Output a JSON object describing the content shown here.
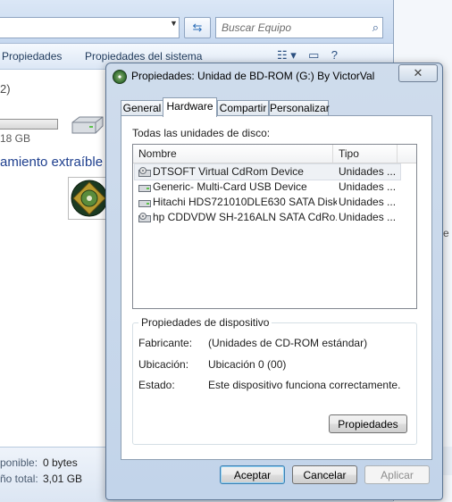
{
  "explorer": {
    "search_placeholder": "Buscar Equipo",
    "toolbar": {
      "properties_label": "Propiedades",
      "system_properties_label": "Propiedades del sistema"
    },
    "count_fragment": "2)",
    "size_fragment": "18 GB",
    "section_fragment": "amiento extraíble",
    "status": {
      "free_label": "ponible:",
      "free_value": "0 bytes",
      "total_label": "ño total:",
      "total_value": "3,01 GB"
    },
    "right_edge_letter": "e"
  },
  "dialog": {
    "title": "Propiedades: Unidad de BD-ROM (G:) By VictorVal",
    "close_glyph": "✕",
    "tabs": [
      {
        "label": "General"
      },
      {
        "label": "Hardware"
      },
      {
        "label": "Compartir"
      },
      {
        "label": "Personalizar"
      }
    ],
    "active_tab": "Hardware",
    "drives_label": "Todas las unidades de disco:",
    "columns": {
      "name": "Nombre",
      "type": "Tipo"
    },
    "devices": [
      {
        "name": "DTSOFT Virtual CdRom Device",
        "type": "Unidades ..."
      },
      {
        "name": "Generic- Multi-Card USB Device",
        "type": "Unidades ..."
      },
      {
        "name": "Hitachi HDS721010DLE630 SATA Disk...",
        "type": "Unidades ..."
      },
      {
        "name": "hp CDDVDW SH-216ALN SATA CdRo...",
        "type": "Unidades ..."
      }
    ],
    "device_properties": {
      "title": "Propiedades de dispositivo",
      "manufacturer_label": "Fabricante:",
      "manufacturer_value": "(Unidades de CD-ROM estándar)",
      "location_label": "Ubicación:",
      "location_value": "Ubicación 0 (00)",
      "status_label": "Estado:",
      "status_value": "Este dispositivo funciona correctamente.",
      "properties_button": "Propiedades"
    },
    "buttons": {
      "accept": "Aceptar",
      "cancel": "Cancelar",
      "apply": "Aplicar"
    }
  }
}
